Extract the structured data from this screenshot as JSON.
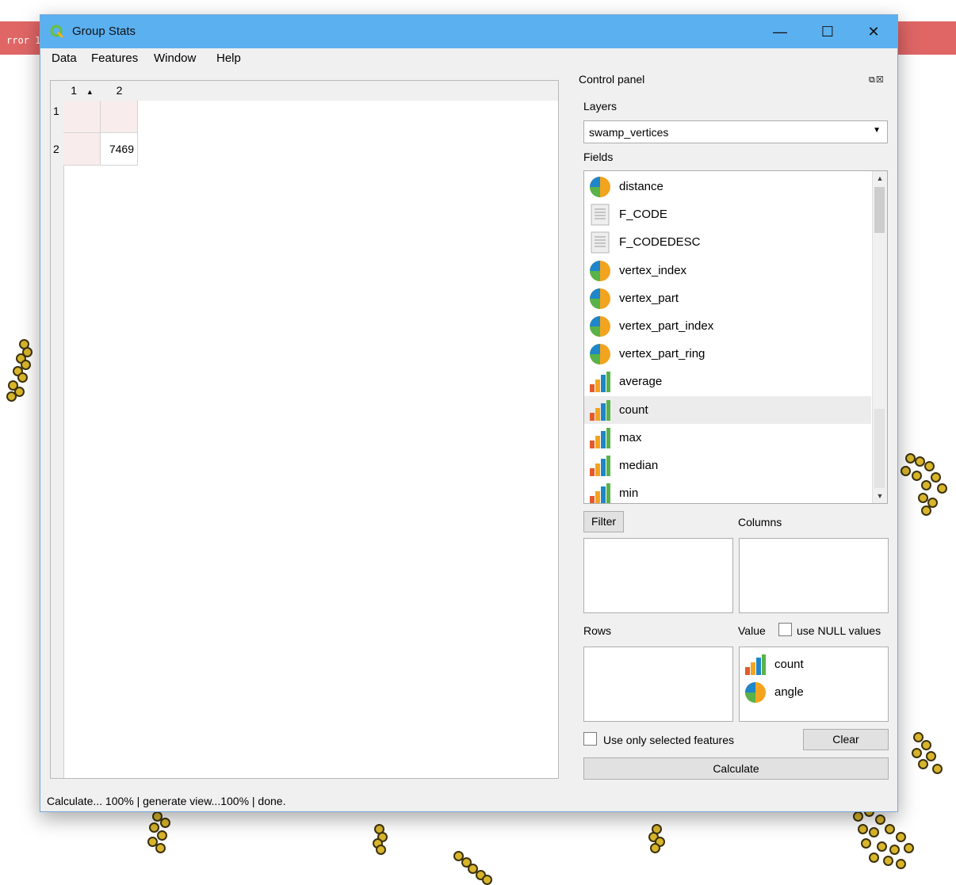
{
  "background": {
    "error_text": "rror 1:"
  },
  "window": {
    "title": "Group Stats",
    "minimize_symbol": "—",
    "maximize_symbol": "☐",
    "close_symbol": "✕"
  },
  "menu": {
    "data": "Data",
    "features": "Features",
    "window": "Window",
    "help": "Help"
  },
  "table": {
    "col_headers": [
      "1",
      "2"
    ],
    "sort_indicator": "▲",
    "row_headers": [
      "1",
      "2"
    ],
    "rows": [
      [
        "",
        ""
      ],
      [
        "",
        "7469"
      ]
    ]
  },
  "panel": {
    "title": "Control panel",
    "layers_label": "Layers",
    "layer_value": "swamp_vertices",
    "fields_label": "Fields",
    "fields": [
      {
        "name": "distance",
        "icon": "pie-icon"
      },
      {
        "name": "F_CODE",
        "icon": "text-icon"
      },
      {
        "name": "F_CODEDESC",
        "icon": "text-icon"
      },
      {
        "name": "vertex_index",
        "icon": "pie-icon"
      },
      {
        "name": "vertex_part",
        "icon": "pie-icon"
      },
      {
        "name": "vertex_part_index",
        "icon": "pie-icon"
      },
      {
        "name": "vertex_part_ring",
        "icon": "pie-icon"
      },
      {
        "name": "average",
        "icon": "bar-chart-icon"
      },
      {
        "name": "count",
        "icon": "bar-chart-icon"
      },
      {
        "name": "max",
        "icon": "bar-chart-icon"
      },
      {
        "name": "median",
        "icon": "bar-chart-icon"
      },
      {
        "name": "min",
        "icon": "bar-chart-icon"
      }
    ],
    "selected_field": "count",
    "filter_button": "Filter",
    "columns_label": "Columns",
    "rows_label": "Rows",
    "value_label": "Value",
    "use_null_label": "use NULL values",
    "use_null_checked": false,
    "value_items": [
      {
        "name": "count",
        "icon": "bar-chart-icon"
      },
      {
        "name": "angle",
        "icon": "pie-icon"
      }
    ],
    "use_selected_label": "Use only selected features",
    "use_selected_checked": false,
    "clear_button": "Clear",
    "calculate_button": "Calculate"
  },
  "status": "Calculate... 100% | generate view...100% |  done.",
  "colors": {
    "titlebar": "#5bb0f0",
    "error_bar": "#e06666",
    "selected_row": "#ececec",
    "empty_cell": "#f8ecec"
  }
}
